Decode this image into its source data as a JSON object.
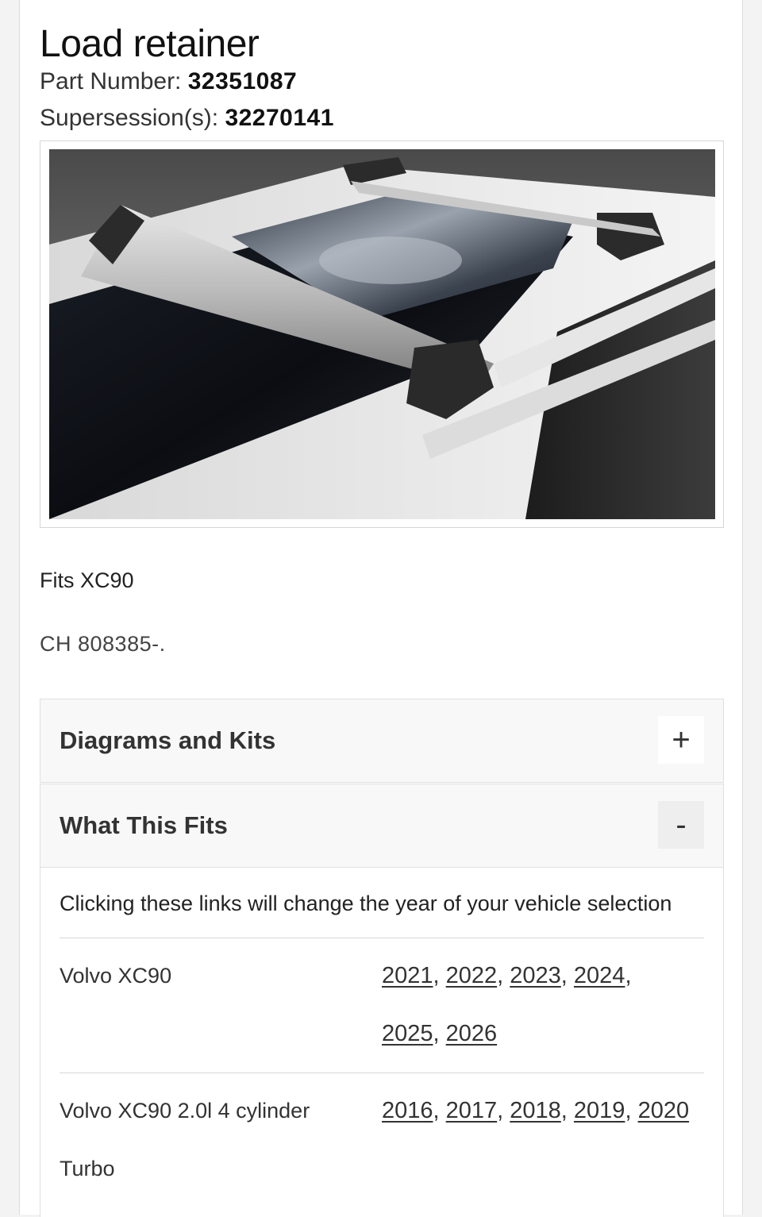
{
  "product": {
    "title": "Load retainer",
    "part_number_label": "Part Number: ",
    "part_number": "32351087",
    "supersession_label": "Supersession(s): ",
    "supersession": "32270141",
    "image_alt": "Load retainer mounted on roof rails",
    "fits_text": "Fits XC90",
    "chassis_note": "CH 808385-."
  },
  "accordions": [
    {
      "title": "Diagrams and Kits",
      "toggle": "+",
      "state": "collapsed"
    },
    {
      "title": "What This Fits",
      "toggle": "-",
      "state": "expanded"
    }
  ],
  "fitment": {
    "note": "Clicking these links will change the year of your vehicle selection",
    "rows": [
      {
        "model": "Volvo XC90",
        "years": [
          "2021",
          "2022",
          "2023",
          "2024",
          "2025",
          "2026"
        ]
      },
      {
        "model": "Volvo XC90 2.0l 4 cylinder Turbo",
        "years": [
          "2016",
          "2017",
          "2018",
          "2019",
          "2020"
        ]
      }
    ]
  },
  "colors": {
    "page_bg": "#f3f3f3",
    "card_bg": "#ffffff",
    "header_bg": "#f8f8f8"
  }
}
